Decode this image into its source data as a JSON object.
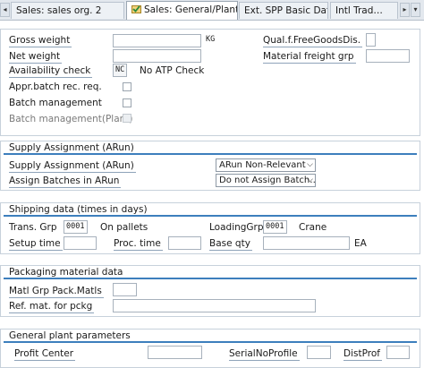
{
  "tabs": [
    {
      "label": "Sales: sales org. 2",
      "active": false
    },
    {
      "label": "Sales: General/Plant",
      "active": true
    },
    {
      "label": "Ext. SPP Basic Data",
      "active": false
    },
    {
      "label": "Intl Trad…",
      "active": false
    }
  ],
  "general": {
    "gross_weight_label": "Gross weight",
    "gross_weight_value": "",
    "weight_unit": "KG",
    "qual_free_goods_label": "Qual.f.FreeGoodsDis.",
    "qual_free_goods_value": "",
    "net_weight_label": "Net weight",
    "net_weight_value": "",
    "material_freight_label": "Material freight grp",
    "material_freight_value": "",
    "availability_label": "Availability check",
    "availability_code": "NC",
    "availability_text": "No ATP Check",
    "appr_batch_label": "Appr.batch rec. req.",
    "appr_batch_checked": false,
    "batch_mgmt_label": "Batch management",
    "batch_mgmt_checked": false,
    "batch_mgmt_plant_label": "Batch management(Plant)",
    "batch_mgmt_plant_checked": false
  },
  "supply": {
    "title": "Supply Assignment (ARun)",
    "assignment_label": "Supply Assignment (ARun)",
    "assignment_value": "ARun Non-Relevant",
    "batches_label": "Assign Batches in ARun",
    "batches_value": "Do not Assign Batch…"
  },
  "shipping": {
    "title": "Shipping data (times in days)",
    "trans_grp_label": "Trans. Grp",
    "trans_grp_value": "0001",
    "trans_grp_text": "On pallets",
    "loading_grp_label": "LoadingGrp",
    "loading_grp_value": "0001",
    "loading_grp_text": "Crane",
    "setup_time_label": "Setup time",
    "setup_time_value": "",
    "proc_time_label": "Proc. time",
    "proc_time_value": "",
    "base_qty_label": "Base qty",
    "base_qty_value": "",
    "base_qty_unit": "EA"
  },
  "packaging": {
    "title": "Packaging material data",
    "matl_grp_label": "Matl Grp Pack.Matls",
    "matl_grp_value": "",
    "ref_mat_label": "Ref. mat. for pckg",
    "ref_mat_value": ""
  },
  "plant": {
    "title": "General plant parameters",
    "profit_center_label": "Profit Center",
    "profit_center_value": "",
    "serial_no_label": "SerialNoProfile",
    "serial_no_value": "",
    "dist_prof_label": "DistProf",
    "dist_prof_value": ""
  },
  "colors": {
    "accent": "#3d7fbd",
    "active_tab_icon": "#2e8b3e"
  },
  "icons": {
    "active_tab": "check-folder-icon",
    "nav_left": "chevron-left-icon",
    "nav_right": "chevron-right-icon",
    "dropdown": "chevron-down-icon"
  }
}
